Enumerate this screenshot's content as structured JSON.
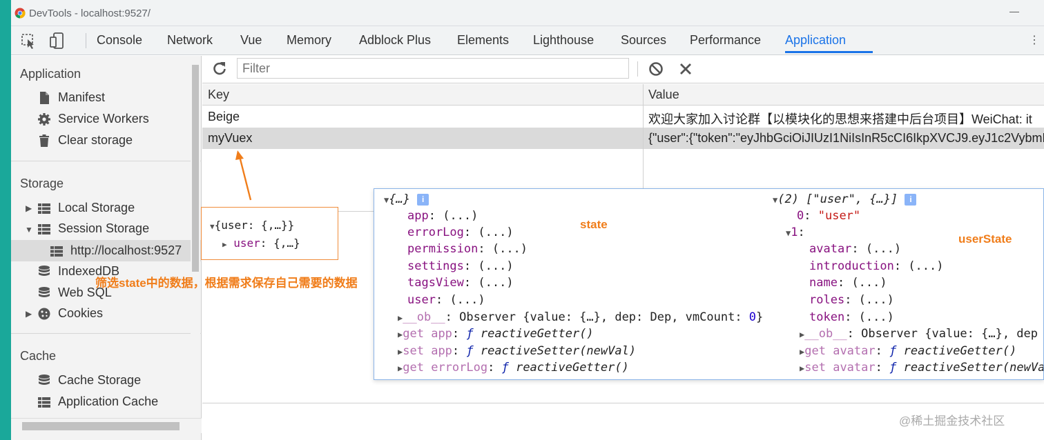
{
  "window": {
    "title": "DevTools - localhost:9527/"
  },
  "tabs": [
    {
      "label": "Console"
    },
    {
      "label": "Network"
    },
    {
      "label": "Vue"
    },
    {
      "label": "Memory"
    },
    {
      "label": "Adblock Plus"
    },
    {
      "label": "Elements"
    },
    {
      "label": "Lighthouse"
    },
    {
      "label": "Sources"
    },
    {
      "label": "Performance"
    },
    {
      "label": "Application"
    }
  ],
  "active_tab": "Application",
  "sidebar": {
    "application": {
      "heading": "Application",
      "items": [
        {
          "label": "Manifest",
          "icon": "file-icon"
        },
        {
          "label": "Service Workers",
          "icon": "gear-icon"
        },
        {
          "label": "Clear storage",
          "icon": "trash-icon"
        }
      ]
    },
    "storage": {
      "heading": "Storage",
      "items": [
        {
          "label": "Local Storage",
          "icon": "grid-icon"
        },
        {
          "label": "Session Storage",
          "icon": "grid-icon"
        },
        {
          "label": "http://localhost:9527",
          "icon": "grid-icon"
        },
        {
          "label": "IndexedDB",
          "icon": "database-icon"
        },
        {
          "label": "Web SQL",
          "icon": "database-icon"
        },
        {
          "label": "Cookies",
          "icon": "cookie-icon"
        }
      ]
    },
    "cache": {
      "heading": "Cache",
      "items": [
        {
          "label": "Cache Storage",
          "icon": "database-icon"
        },
        {
          "label": "Application Cache",
          "icon": "grid-icon"
        }
      ]
    }
  },
  "filter": {
    "placeholder": "Filter"
  },
  "table": {
    "columns": [
      "Key",
      "Value"
    ],
    "rows": [
      {
        "key": "Beige",
        "value": "欢迎大家加入讨论群【以模块化的思想来搭建中后台项目】WeiChat: it"
      },
      {
        "key": "myVuex",
        "value": "{\"user\":{\"token\":\"eyJhbGciOiJIUzI1NiIsInR5cCI6IkpXVCJ9.eyJ1c2VybmFt"
      }
    ]
  },
  "preview": {
    "line1": "{user: {,…}}",
    "line2_key": "user",
    "line2_val": "{,…}"
  },
  "annotations": {
    "filter_note": "筛选state中的数据，根据需求保存自己需要的数据",
    "state": "state",
    "user_state": "userState"
  },
  "popup_left": {
    "header": "{…}",
    "props": [
      {
        "key": "app",
        "val": "(...)"
      },
      {
        "key": "errorLog",
        "val": "(...)"
      },
      {
        "key": "permission",
        "val": "(...)"
      },
      {
        "key": "settings",
        "val": "(...)"
      },
      {
        "key": "tagsView",
        "val": "(...)"
      },
      {
        "key": "user",
        "val": "(...)"
      }
    ],
    "ob_line": {
      "key": "__ob__",
      "type": "Observer",
      "body_a": "{value: {…}, dep: Dep, vmCount: ",
      "count": "0",
      "body_b": "}"
    },
    "accessors": [
      {
        "kw": "get",
        "name": "app",
        "fn": "reactiveGetter()"
      },
      {
        "kw": "set",
        "name": "app",
        "fn": "reactiveSetter(newVal)"
      },
      {
        "kw": "get",
        "name": "errorLog",
        "fn": "reactiveGetter()"
      }
    ]
  },
  "popup_right": {
    "header": "(2) [\"user\", {…}]",
    "index0": "0",
    "index0_val": "\"user\"",
    "index1": "1",
    "props": [
      {
        "key": "avatar",
        "val": "(...)"
      },
      {
        "key": "introduction",
        "val": "(...)"
      },
      {
        "key": "name",
        "val": "(...)"
      },
      {
        "key": "roles",
        "val": "(...)"
      },
      {
        "key": "token",
        "val": "(...)"
      }
    ],
    "ob_line": {
      "key": "__ob__",
      "text": "Observer {value: {…}, dep"
    },
    "accessors": [
      {
        "kw": "get",
        "name": "avatar",
        "fn": "reactiveGetter()"
      },
      {
        "kw": "set",
        "name": "avatar",
        "fn": "reactiveSetter(newVa"
      }
    ]
  },
  "watermark": "@稀土掘金技术社区",
  "colors": {
    "accent": "#1a73e8",
    "annotation": "#f07d1a",
    "teal": "#1aa89a"
  }
}
